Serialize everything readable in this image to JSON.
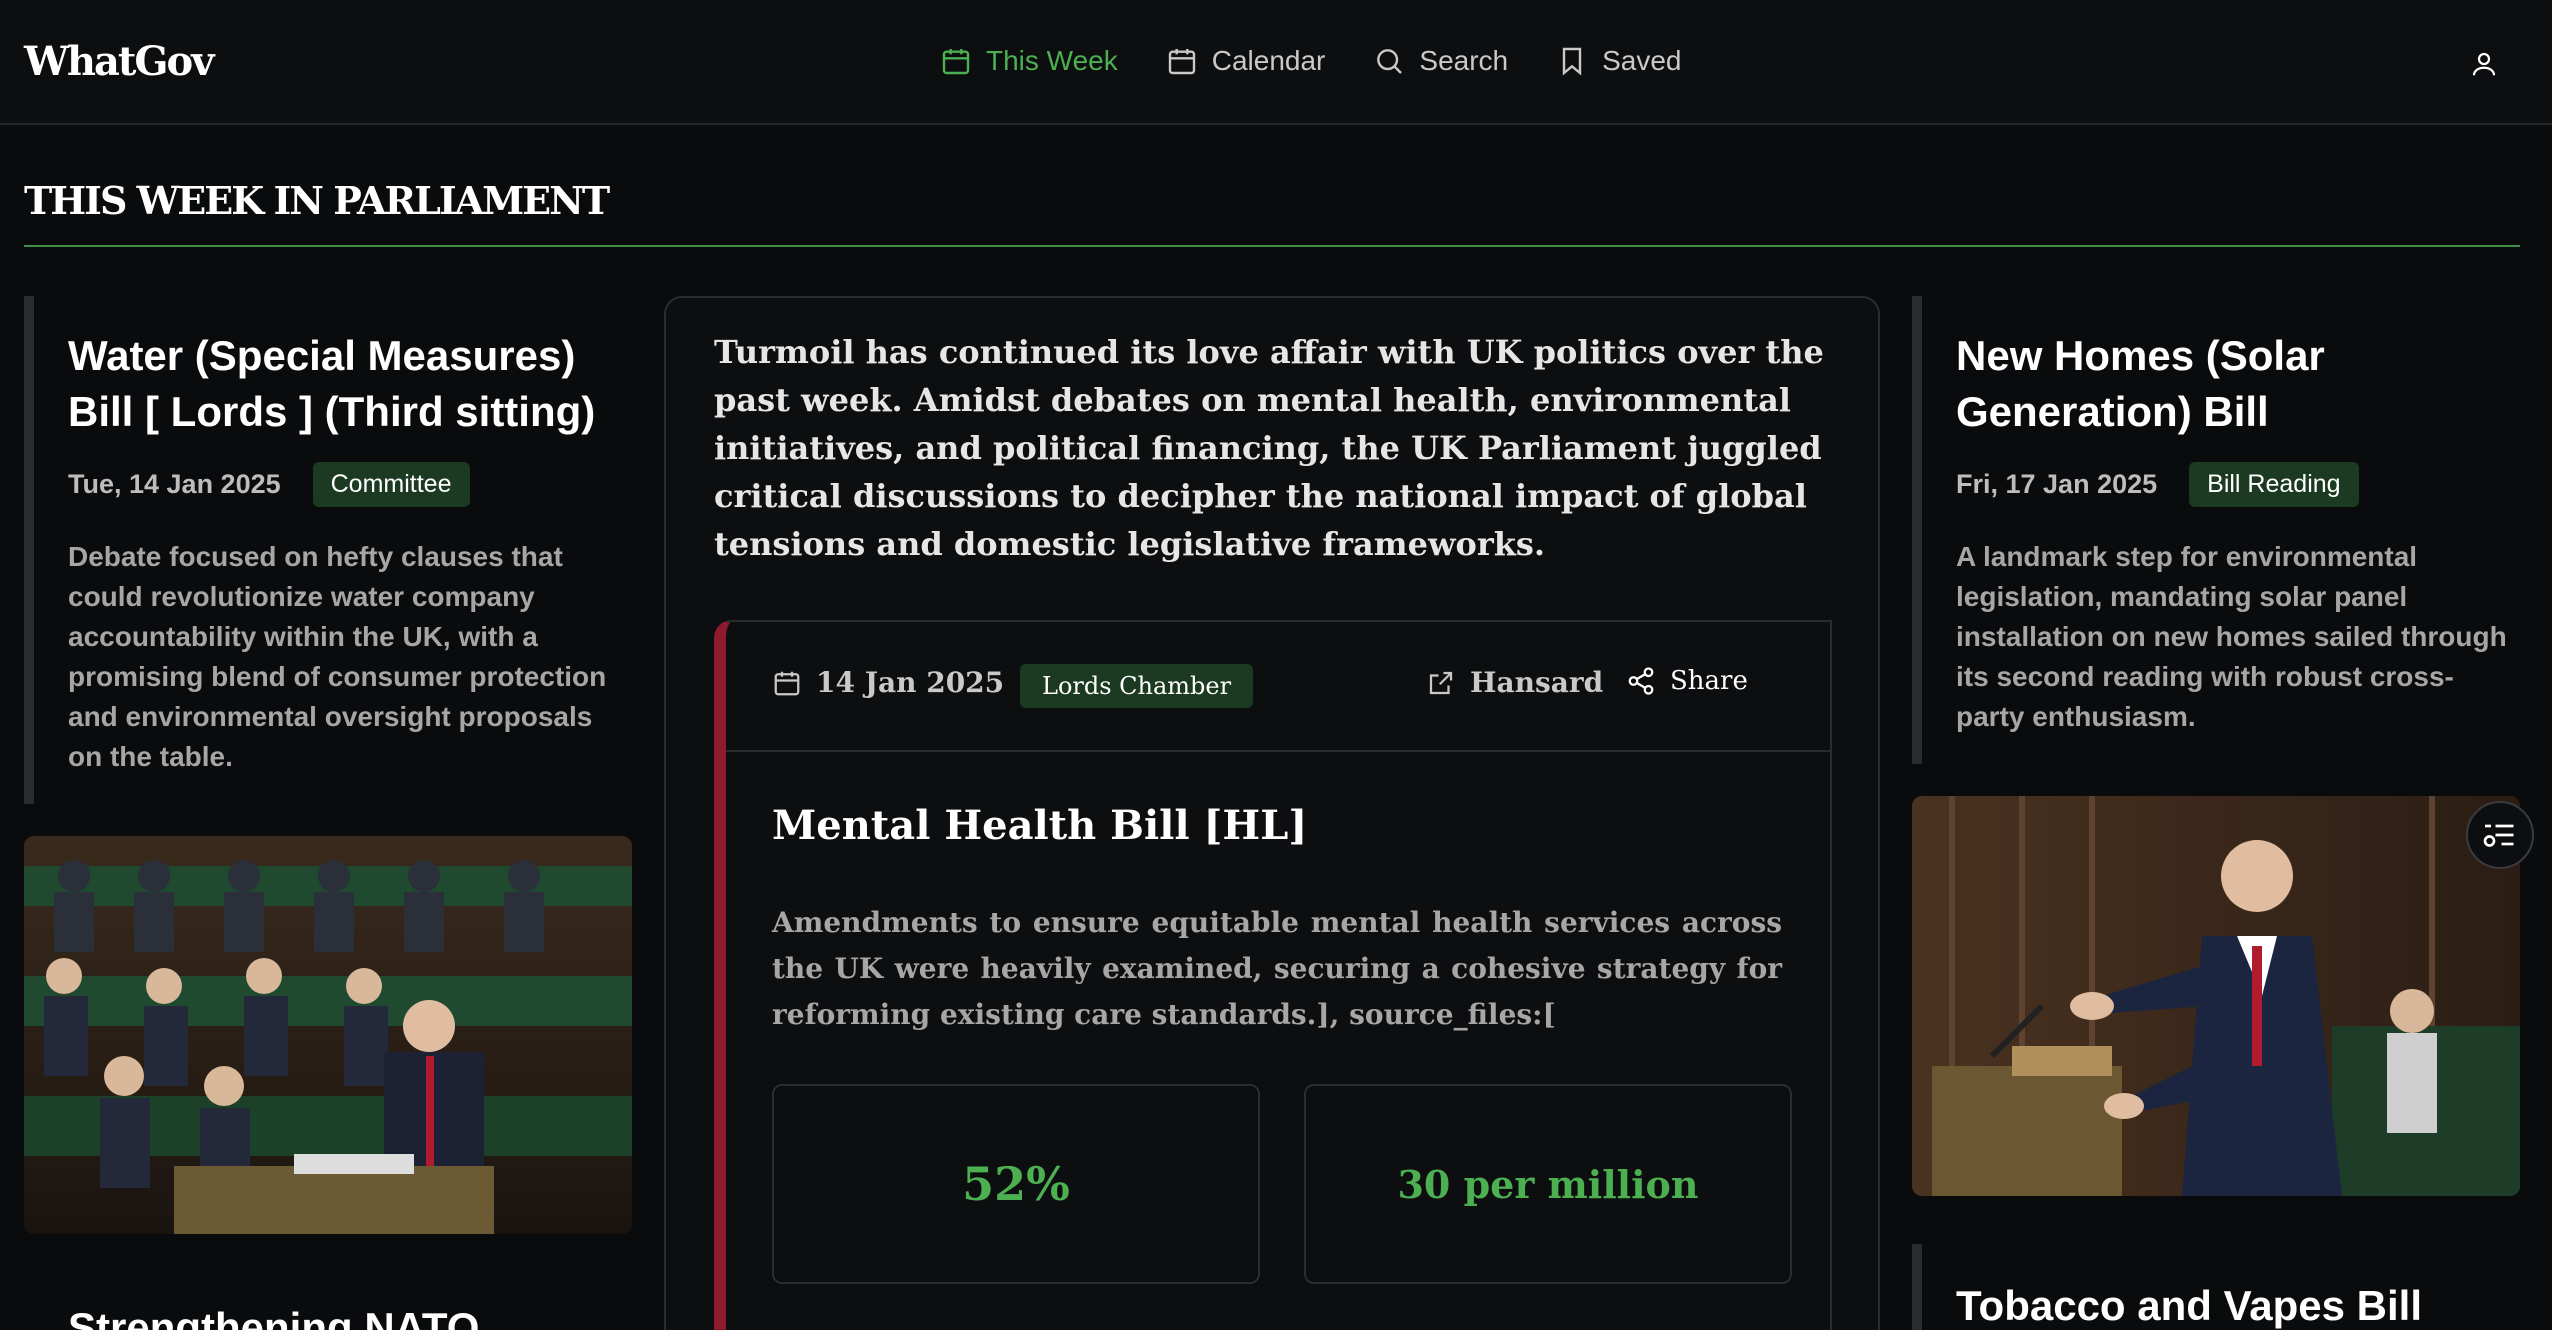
{
  "header": {
    "logo": "WhatGov",
    "nav": [
      {
        "label": "This Week",
        "icon": "calendar-icon",
        "active": true
      },
      {
        "label": "Calendar",
        "icon": "calendar-icon",
        "active": false
      },
      {
        "label": "Search",
        "icon": "search-icon",
        "active": false
      },
      {
        "label": "Saved",
        "icon": "bookmark-icon",
        "active": false
      }
    ],
    "user_icon": "user-icon"
  },
  "section": {
    "title": "THIS WEEK IN PARLIAMENT"
  },
  "left_card": {
    "title": "Water (Special Measures) Bill [ Lords ] (Third sitting)",
    "date": "Tue, 14 Jan 2025",
    "badge": "Committee",
    "summary": "Debate focused on hefty clauses that could revolutionize water company accountability within the UK, with a promising blend of consumer protection and environmental oversight proposals on the table."
  },
  "left_partial_title": "Strengthening NATO",
  "center": {
    "lead": "Turmoil has continued its love affair with UK politics over the past week. Amidst debates on mental health, environmental initiatives, and political financing, the UK Parliament juggled critical discussions to decipher the national impact of global tensions and domestic legislative frameworks.",
    "story": {
      "date": "14 Jan 2025",
      "chamber": "Lords Chamber",
      "hansard_label": "Hansard",
      "share_label": "Share",
      "title": "Mental Health Bill [HL]",
      "body": "Amendments to ensure equitable mental health services across the UK were heavily examined, securing a cohesive strategy for reforming existing care standards.],  source_files:[",
      "stats": [
        "52%",
        "30 per million"
      ]
    }
  },
  "right_card": {
    "title": "New Homes (Solar Generation) Bill",
    "date": "Fri, 17 Jan 2025",
    "badge": "Bill Reading",
    "summary": "A landmark step for environmental legislation, mandating solar panel installation on new homes sailed through its second reading with robust cross-party enthusiasm."
  },
  "right_partial_title": "Tobacco and Vapes Bill",
  "colors": {
    "accent": "#4caf50",
    "badge_bg": "#1c3a22",
    "story_border": "#8e1a2e",
    "background": "#0a0b0d"
  }
}
